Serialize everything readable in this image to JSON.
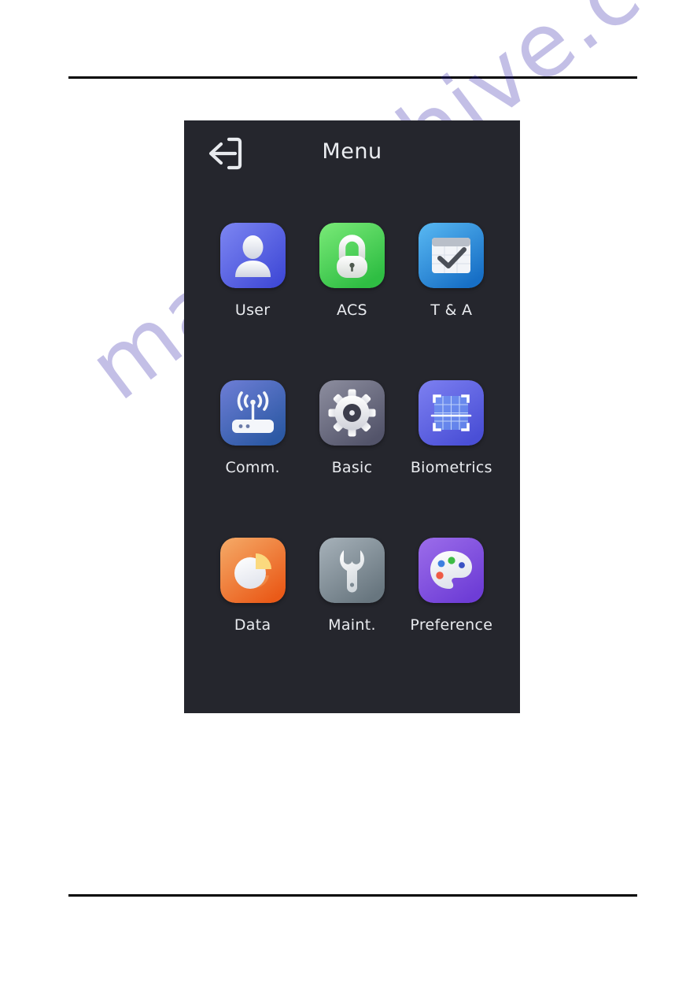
{
  "document": {
    "background_color": "#ffffff",
    "rule_color": "#000000",
    "watermark_text": "manualshive.com",
    "watermark_color": "#3b2fae"
  },
  "device": {
    "background_color": "#25262d",
    "header": {
      "back_icon": "back-exit-arrow-icon",
      "title": "Menu",
      "title_color": "#eceef2"
    },
    "menu_items": [
      {
        "label": "User",
        "icon": "user-person-icon",
        "tile_color_from": "#7a83ef",
        "tile_color_to": "#3d47d8"
      },
      {
        "label": "ACS",
        "icon": "padlock-icon",
        "tile_color_from": "#78e878",
        "tile_color_to": "#31c245"
      },
      {
        "label": "T & A",
        "icon": "calendar-check-icon",
        "tile_color_from": "#53b4f0",
        "tile_color_to": "#1a73c8"
      },
      {
        "label": "Comm.",
        "icon": "router-wifi-icon",
        "tile_color_from": "#6a7ad0",
        "tile_color_to": "#2f5ea8"
      },
      {
        "label": "Basic",
        "icon": "gear-icon",
        "tile_color_from": "#8a8b9c",
        "tile_color_to": "#55566a"
      },
      {
        "label": "Biometrics",
        "icon": "biometric-scan-grid-icon",
        "tile_color_from": "#7b7ef0",
        "tile_color_to": "#4a4fd8"
      },
      {
        "label": "Data",
        "icon": "pie-chart-icon",
        "tile_color_from": "#f3a460",
        "tile_color_to": "#ec5f1e"
      },
      {
        "label": "Maint.",
        "icon": "wrench-icon",
        "tile_color_from": "#a3afb8",
        "tile_color_to": "#6b7a86"
      },
      {
        "label": "Preference",
        "icon": "paint-palette-icon",
        "tile_color_from": "#9a6ae8",
        "tile_color_to": "#7040d8"
      }
    ],
    "palette_dot_colors": [
      "#3d7fe0",
      "#3dbb44",
      "#3a52c4",
      "#ef5a45"
    ]
  }
}
